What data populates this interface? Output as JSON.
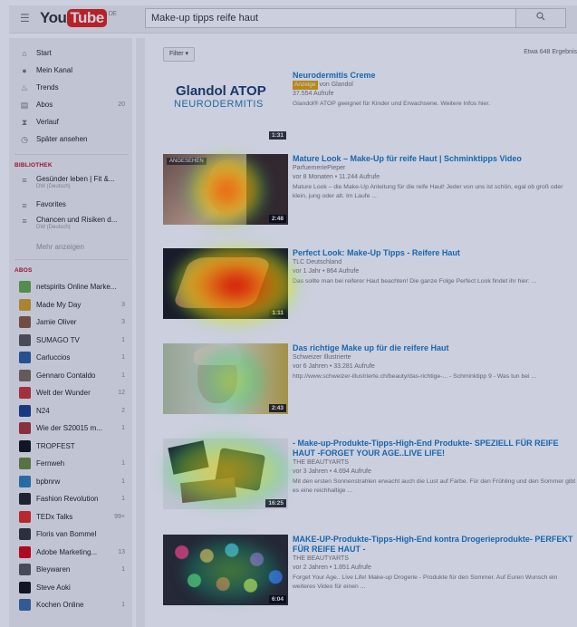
{
  "header": {
    "menu_icon": "hamburger-icon",
    "logo_you": "You",
    "logo_tube": "Tube",
    "logo_region": "DE",
    "search_value": "Make-up tipps reife haut",
    "search_icon": "search-icon"
  },
  "sidebar": {
    "nav": [
      {
        "icon": "home-icon",
        "label": "Start",
        "count": ""
      },
      {
        "icon": "user-icon",
        "label": "Mein Kanal",
        "count": ""
      },
      {
        "icon": "flame-icon",
        "label": "Trends",
        "count": ""
      },
      {
        "icon": "subscriptions-icon",
        "label": "Abos",
        "count": "20"
      },
      {
        "icon": "hourglass-icon",
        "label": "Verlauf",
        "count": ""
      },
      {
        "icon": "clock-icon",
        "label": "Später ansehen",
        "count": ""
      }
    ],
    "library_title": "BIBLIOTHEK",
    "library": [
      {
        "label": "Gesünder leben | Fit &...",
        "sub": "DW (Deutsch)"
      },
      {
        "label": "Favorites",
        "sub": ""
      },
      {
        "label": "Chancen und Risiken d...",
        "sub": "DW (Deutsch)"
      }
    ],
    "more_label": "Mehr anzeigen",
    "abos_title": "ABOS",
    "abos": [
      {
        "label": "netspirits Online Marke...",
        "count": "",
        "color": "#6a4"
      },
      {
        "label": "Made My Day",
        "count": "3",
        "color": "#d4a020"
      },
      {
        "label": "Jamie Oliver",
        "count": "3",
        "color": "#8a5a3a"
      },
      {
        "label": "SUMAGO TV",
        "count": "1",
        "color": "#555"
      },
      {
        "label": "Carluccios",
        "count": "1",
        "color": "#2a5d9f"
      },
      {
        "label": "Gennaro Contaldo",
        "count": "1",
        "color": "#7a6a55"
      },
      {
        "label": "Welt der Wunder",
        "count": "12",
        "color": "#c33"
      },
      {
        "label": "N24",
        "count": "2",
        "color": "#1a3e8a"
      },
      {
        "label": "Wie der S20015 m...",
        "count": "1",
        "color": "#a33"
      },
      {
        "label": "TROPFEST",
        "count": "",
        "color": "#111"
      },
      {
        "label": "Fernweh",
        "count": "1",
        "color": "#6a8a3a"
      },
      {
        "label": "bpbnrw",
        "count": "1",
        "color": "#2c7fb8"
      },
      {
        "label": "Fashion Revolution",
        "count": "1",
        "color": "#222"
      },
      {
        "label": "TEDx Talks",
        "count": "99+",
        "color": "#e62b1e"
      },
      {
        "label": "Floris van Bommel",
        "count": "",
        "color": "#333"
      },
      {
        "label": "Adobe Marketing...",
        "count": "13",
        "color": "#d01"
      },
      {
        "label": "Bleywaren",
        "count": "1",
        "color": "#555"
      },
      {
        "label": "Steve Aoki",
        "count": "",
        "color": "#111"
      },
      {
        "label": "Kochen Online",
        "count": "1",
        "color": "#3a6aa0"
      }
    ]
  },
  "results": {
    "filter_label": "Filter ▾",
    "count_label": "Etwa 648 Ergebnis",
    "items": [
      {
        "title": "Neurodermitis Creme",
        "ad_label": "Anzeige",
        "channel": "von Glandol",
        "meta": "37.554 Aufrufe",
        "desc": "Glandol® ATOP geeignet für Kinder und Erwachsene. Weitere Infos hier.",
        "duration": "1:31",
        "thumb_text_1": "Glandol ATOP",
        "thumb_text_2": "NEURODERMITIS"
      },
      {
        "title": "Mature Look – Make-Up für reife Haut | Schminktipps Video",
        "channel": "ParfuemeriePieper",
        "meta": "vor 8 Monaten • 11.244 Aufrufe",
        "desc": "Mature Look – die Make-Up Anleitung für die reife Haut! Jeder von uns ist schön, egal ob groß oder klein, jung oder alt. Im Laufe ...",
        "duration": "2:48",
        "badge": "ANGESEHEN"
      },
      {
        "title": "Perfect Look: Make-Up Tipps - Reifere Haut",
        "channel": "TLC Deutschland",
        "meta": "vor 1 Jahr • 864 Aufrufe",
        "desc": "Das sollte man bei reiferer Haut beachten! Die ganze Folge Perfect Look findet ihr hier: ...",
        "duration": "1:11"
      },
      {
        "title": "Das richtige Make up für die reifere Haut",
        "channel": "Schweizer Illustrierte",
        "meta": "vor 6 Jahren • 33.281 Aufrufe",
        "desc": "http://www.schweizer-illustrierte.ch/beauty/das-richtige-... - Schminktipp 9 - Was tun bei ...",
        "duration": "2:43"
      },
      {
        "title": "- Make-up-Produkte-Tipps-High-End Produkte- SPEZIELL FÜR REIFE HAUT -FORGET YOUR AGE..LIVE LIFE!",
        "channel": "THE BEAUTYARTS",
        "meta": "vor 3 Jahren • 4.694 Aufrufe",
        "desc": "Mit den ersten Sonnenstrahlen erwacht auch die Lust auf Farbe. Für den Frühling und den Sommer gibt es eine reichhaltige ...",
        "duration": "16:25"
      },
      {
        "title": "MAKE-UP-Produkte-Tipps-High-End kontra Drogerieprodukte- PERFEKT FÜR REIFE HAUT -",
        "channel": "THE BEAUTYARTS",
        "meta": "vor 2 Jahren • 1.851 Aufrufe",
        "desc": "Forget Your Age.. Live Life! Make-up Drogerie - Produkte für den Sommer. Auf Euren Wunsch ein weiteres Video für einen ...",
        "duration": "6:04"
      }
    ]
  }
}
